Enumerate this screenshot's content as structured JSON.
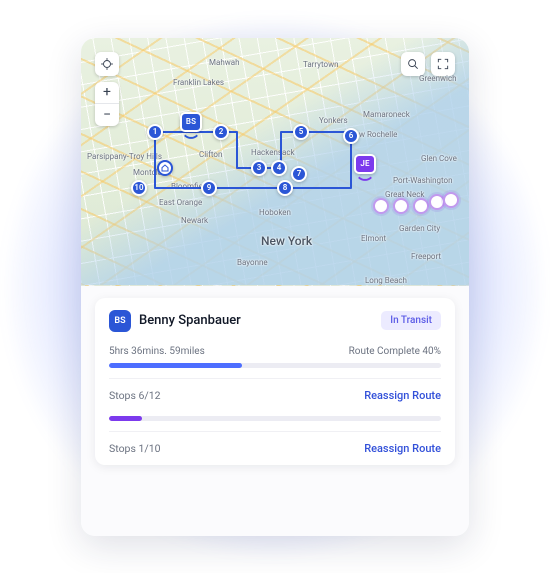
{
  "colors": {
    "primaryBlue": "#2b56d6",
    "primaryPurple": "#7c3aed"
  },
  "map": {
    "controls": {
      "locate": "locate-icon",
      "zoomIn": "+",
      "zoomOut": "−",
      "search": "search-icon",
      "expand": "expand-icon"
    },
    "cities": {
      "newYork": "New York",
      "newark": "Newark",
      "yonkers": "Yonkers",
      "hackensack": "Hackensack",
      "hoboken": "Hoboken",
      "clifton": "Clifton",
      "montclair": "Montclair",
      "bloomfield": "Bloomfield",
      "eastOrange": "East Orange",
      "mahwah": "Mahwah",
      "tarrytown": "Tarrytown",
      "newRochelle": "New Rochelle",
      "mamaroneck": "Mamaroneck",
      "glenCove": "Glen Cove",
      "portWashington": "Port-Washington",
      "greatNeck": "Great Neck",
      "gardenCity": "Garden City",
      "elmont": "Elmont",
      "greenwich": "Greenwich",
      "freeport": "Freeport",
      "longBeach": "Long Beach",
      "bayonne": "Bayonne",
      "parsippany": "Parsippany-Troy Hills",
      "franklinLakes": "Franklin Lakes"
    },
    "drivers": [
      {
        "initials": "BS",
        "color": "blue"
      },
      {
        "initials": "JE",
        "color": "purple"
      }
    ],
    "blueStops": [
      "1",
      "2",
      "3",
      "4",
      "5",
      "6",
      "7",
      "8",
      "9",
      "10"
    ]
  },
  "routes": [
    {
      "driverInitials": "BS",
      "driverName": "Benny Spanbauer",
      "status": "In Transit",
      "timeDistance": "5hrs 36mins.  59miles",
      "completeText": "Route Complete 40%",
      "progressPercent": 40,
      "progressColor": "#4d6eff",
      "stopsText": "Stops  6/12",
      "reassignLabel": "Reassign Route"
    },
    {
      "progressPercent": 10,
      "progressColor": "#7c3aed",
      "stopsText": "Stops  1/10",
      "reassignLabel": "Reassign Route"
    }
  ]
}
